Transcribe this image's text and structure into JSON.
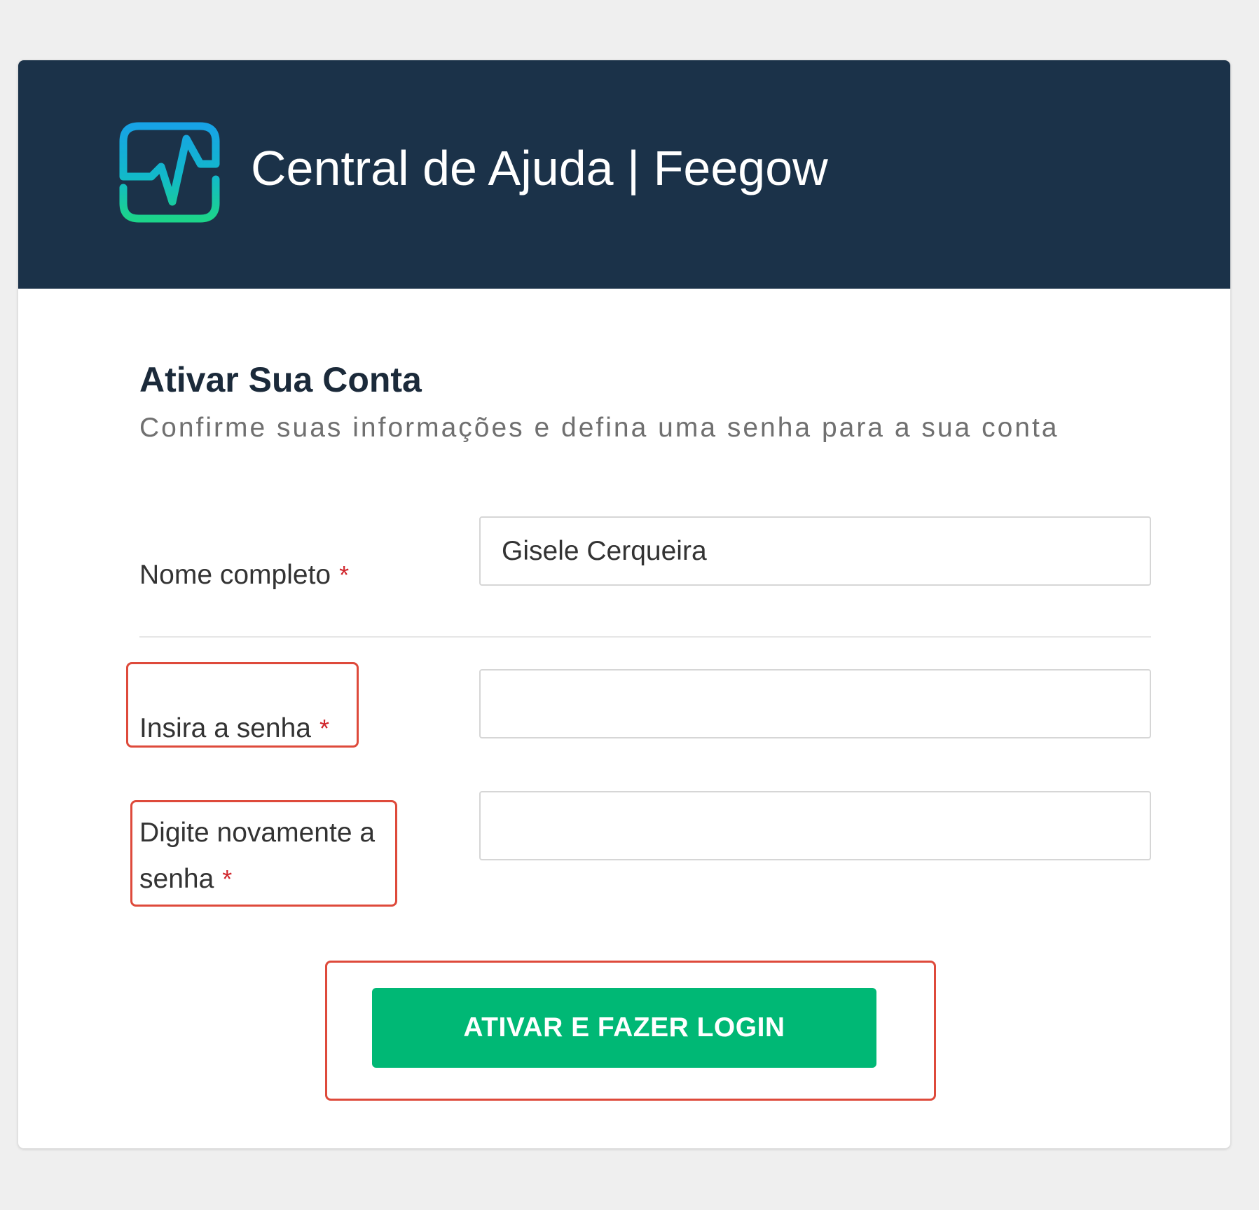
{
  "header": {
    "title": "Central de Ajuda | Feegow",
    "logo_icon": "pulse-square-logo-icon"
  },
  "form": {
    "title": "Ativar Sua Conta",
    "subtitle": "Confirme suas informações e defina uma senha para a sua conta",
    "required_mark": "*",
    "full_name": {
      "label": "Nome completo",
      "value": "Gisele Cerqueira"
    },
    "password": {
      "label": "Insira a senha",
      "value": ""
    },
    "password_confirm": {
      "label_line1": "Digite novamente a",
      "label_line2": "senha",
      "value": ""
    },
    "submit_label": "ATIVAR E FAZER LOGIN"
  },
  "colors": {
    "header_bg": "#1b3249",
    "button_green": "#00b875",
    "required_red": "#d0252b",
    "highlight_red": "#de4a3b"
  }
}
